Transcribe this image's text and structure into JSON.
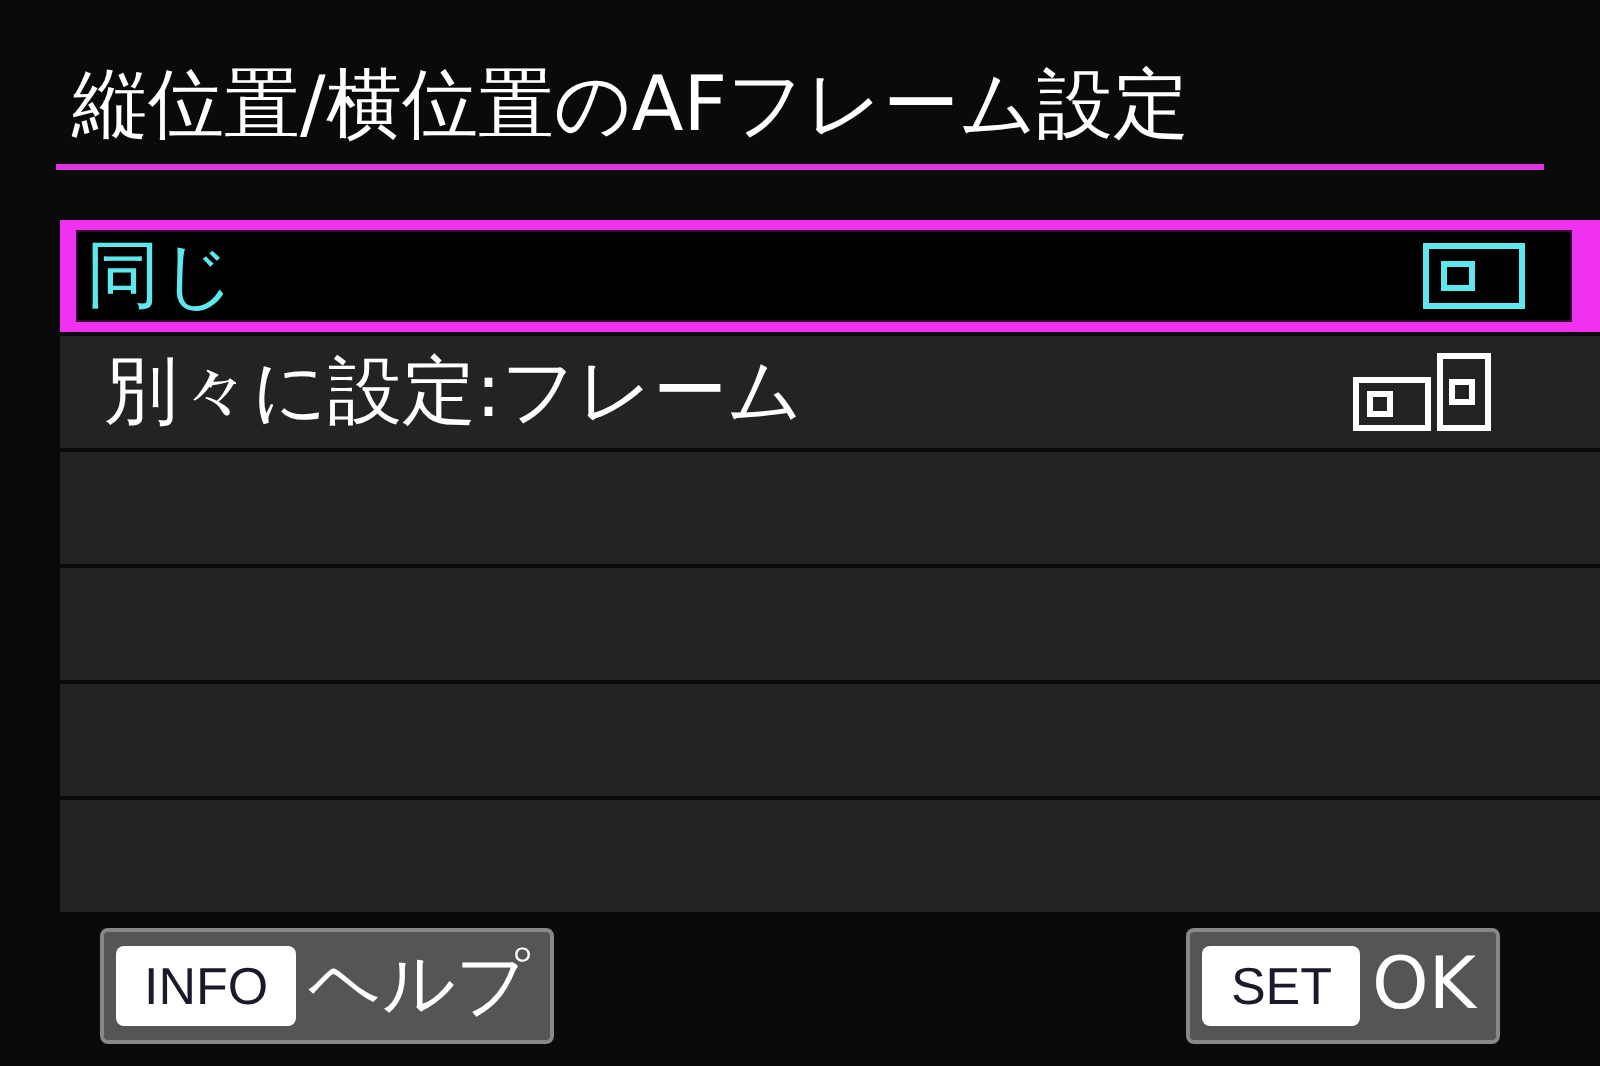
{
  "title": "縦位置/横位置のAFフレーム設定",
  "items": [
    {
      "label": "同じ",
      "selected": true,
      "kind": "same"
    },
    {
      "label": "別々に設定:フレーム",
      "selected": false,
      "kind": "separate"
    }
  ],
  "buttons": [
    {
      "key": "INFO",
      "label": "ヘルプ"
    },
    {
      "key": "SET",
      "label": "OK"
    }
  ]
}
